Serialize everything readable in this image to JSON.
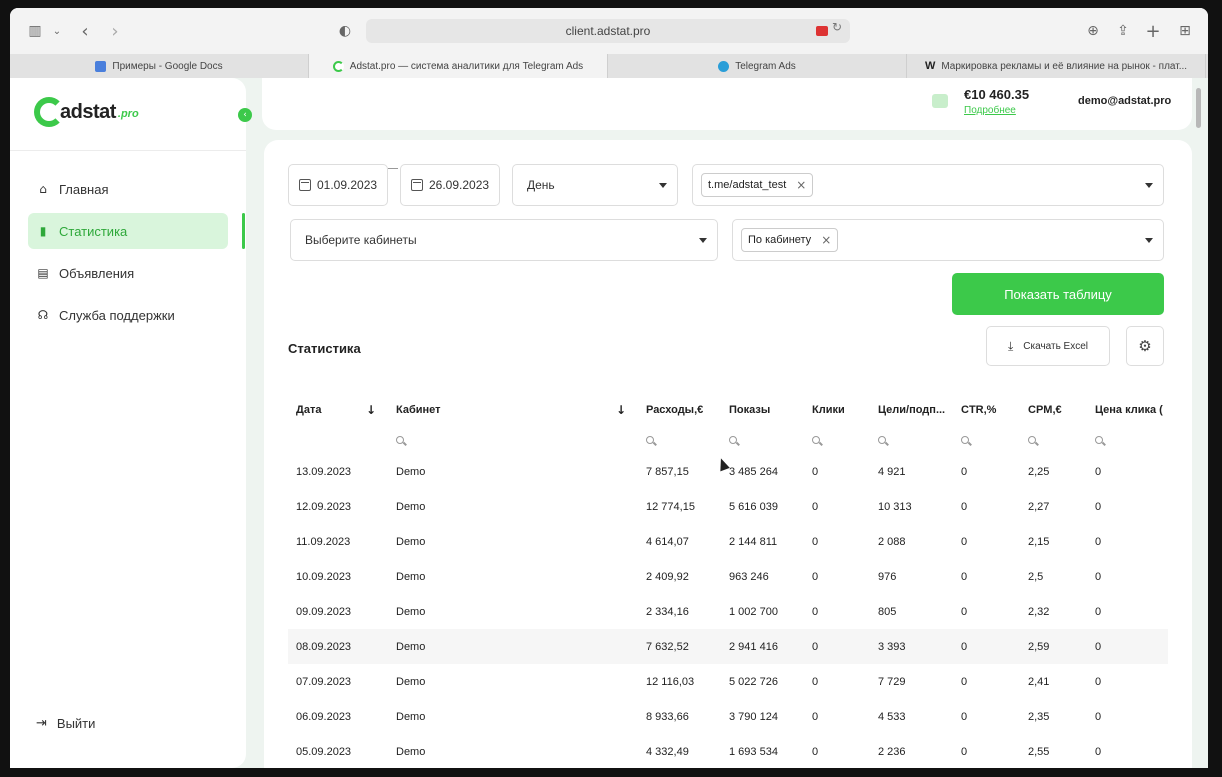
{
  "browser": {
    "url": "client.adstat.pro",
    "tabs": [
      {
        "label": "Примеры - Google Docs",
        "fav_color": "#4a7fdc",
        "active": false
      },
      {
        "label": "Adstat.pro — система аналитики для Telegram Ads",
        "fav_color": "#3cc94a",
        "active": true
      },
      {
        "label": "Telegram Ads",
        "fav_color": "#2a9ed8",
        "active": false
      },
      {
        "label": "Маркировка рекламы и её влияние на рынок - плат...",
        "fav_color": "#ffffff",
        "active": false
      }
    ],
    "tab4_fav_letter": "W"
  },
  "sidebar": {
    "logo_text": "adstat",
    "logo_suffix": ".pro",
    "collapse_glyph": "‹",
    "items": [
      {
        "label": "Главная",
        "icon": "home-icon",
        "glyph": "⌂"
      },
      {
        "label": "Статистика",
        "icon": "chart-icon",
        "glyph": "▮"
      },
      {
        "label": "Объявления",
        "icon": "document-icon",
        "glyph": "▤"
      },
      {
        "label": "Служба поддержки",
        "icon": "headset-icon",
        "glyph": "☊"
      }
    ],
    "logout_label": "Выйти",
    "logout_glyph": "⇥"
  },
  "header": {
    "balance": "€10 460.35",
    "balance_link": "Подробнее",
    "email": "demo@adstat.pro"
  },
  "filters": {
    "date_from": "01.09.2023",
    "date_to": "26.09.2023",
    "period": "День",
    "channel_chip": "t.me/adstat_test",
    "cabinets_placeholder": "Выберите кабинеты",
    "group_chip": "По кабинету",
    "chip_close": "×"
  },
  "actions": {
    "show_table": "Показать таблицу",
    "download_excel": "Скачать Excel",
    "download_glyph": "⤓",
    "settings_glyph": "⚙"
  },
  "stats": {
    "title": "Статистика",
    "sort_glyph": "↓",
    "columns": [
      "Дата",
      "Кабинет",
      "Расходы,€",
      "Показы",
      "Клики",
      "Цели/подп...",
      "CTR,%",
      "CPM,€",
      "Цена клика ("
    ],
    "rows": [
      [
        "13.09.2023",
        "Demo",
        "7 857,15",
        "3 485 264",
        "0",
        "4 921",
        "0",
        "2,25",
        "0"
      ],
      [
        "12.09.2023",
        "Demo",
        "12 774,15",
        "5 616 039",
        "0",
        "10 313",
        "0",
        "2,27",
        "0"
      ],
      [
        "11.09.2023",
        "Demo",
        "4 614,07",
        "2 144 811",
        "0",
        "2 088",
        "0",
        "2,15",
        "0"
      ],
      [
        "10.09.2023",
        "Demo",
        "2 409,92",
        "963 246",
        "0",
        "976",
        "0",
        "2,5",
        "0"
      ],
      [
        "09.09.2023",
        "Demo",
        "2 334,16",
        "1 002 700",
        "0",
        "805",
        "0",
        "2,32",
        "0"
      ],
      [
        "08.09.2023",
        "Demo",
        "7 632,52",
        "2 941 416",
        "0",
        "3 393",
        "0",
        "2,59",
        "0"
      ],
      [
        "07.09.2023",
        "Demo",
        "12 116,03",
        "5 022 726",
        "0",
        "7 729",
        "0",
        "2,41",
        "0"
      ],
      [
        "06.09.2023",
        "Demo",
        "8 933,66",
        "3 790 124",
        "0",
        "4 533",
        "0",
        "2,35",
        "0"
      ],
      [
        "05.09.2023",
        "Demo",
        "4 332,49",
        "1 693 534",
        "0",
        "2 236",
        "0",
        "2,55",
        "0"
      ]
    ]
  }
}
